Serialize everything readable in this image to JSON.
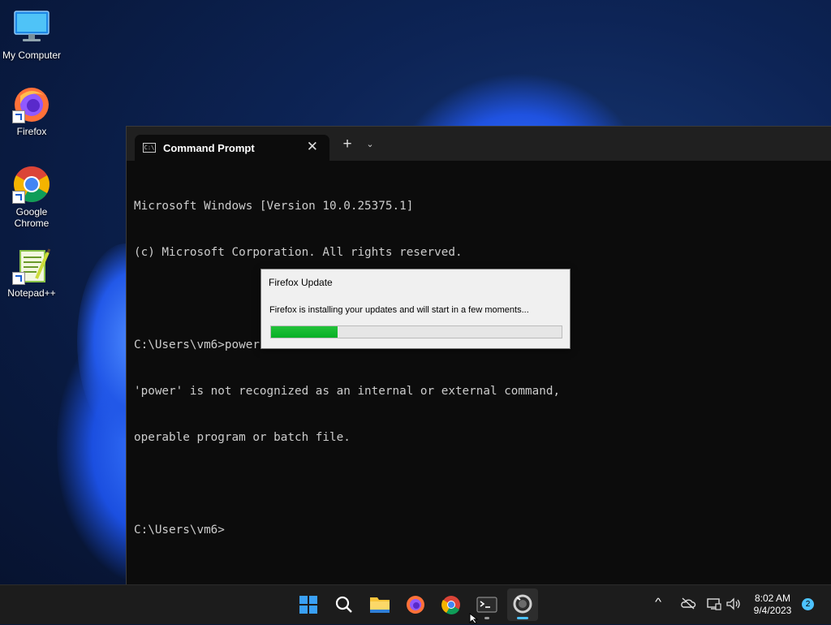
{
  "desktop": {
    "icons": [
      {
        "label": "My Computer",
        "icon": "monitor-icon"
      },
      {
        "label": "Firefox",
        "icon": "firefox-icon"
      },
      {
        "label": "Google Chrome",
        "icon": "chrome-icon"
      },
      {
        "label": "Notepad++",
        "icon": "notepad-plus-plus-icon"
      }
    ]
  },
  "terminal": {
    "tab_title": "Command Prompt",
    "tab_icon": "cmd-icon",
    "tab_icon_text": "C:\\",
    "close_glyph": "✕",
    "new_tab_glyph": "+",
    "dropdown_glyph": "⌄",
    "lines": [
      "Microsoft Windows [Version 10.0.25375.1]",
      "(c) Microsoft Corporation. All rights reserved.",
      "",
      "C:\\Users\\vm6>power windows un",
      "'power' is not recognized as an internal or external command,",
      "operable program or batch file.",
      "",
      "C:\\Users\\vm6>"
    ]
  },
  "firefox_update": {
    "title": "Firefox Update",
    "message": "Firefox is installing your updates and will start in a few moments...",
    "progress": 0.23
  },
  "taskbar": {
    "items": [
      {
        "name": "start-button",
        "icon": "windows-logo-icon"
      },
      {
        "name": "search-button",
        "icon": "search-icon"
      },
      {
        "name": "file-explorer-button",
        "icon": "folder-icon"
      },
      {
        "name": "firefox-taskbar-button",
        "icon": "firefox-icon"
      },
      {
        "name": "chrome-taskbar-button",
        "icon": "chrome-icon"
      },
      {
        "name": "terminal-taskbar-button",
        "icon": "terminal-icon"
      },
      {
        "name": "firefox-update-taskbar-button",
        "icon": "firefox-update-icon"
      }
    ],
    "tray": {
      "chevron_glyph": "^",
      "time": "8:02 AM",
      "date": "9/4/2023",
      "notifications": "2"
    }
  }
}
